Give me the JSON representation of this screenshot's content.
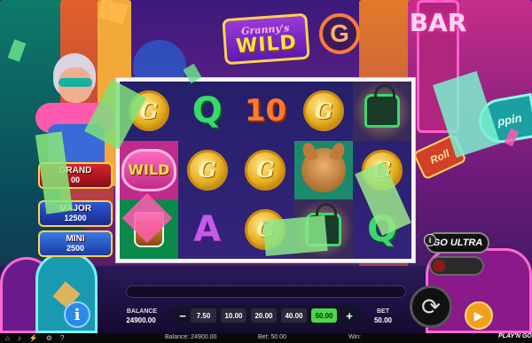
{
  "game": {
    "logo_top": "Granny's",
    "logo_main": "WILD"
  },
  "scene_signs": {
    "bar_sign": "BAR",
    "circle_sign": "G",
    "side_sign": "ppin",
    "side_sign2": "Roll"
  },
  "jackpots": [
    {
      "label": "GRAND",
      "value": "00"
    },
    {
      "label": "MAJOR",
      "value": "12500"
    },
    {
      "label": "MINI",
      "value": "2500"
    }
  ],
  "reels": [
    [
      "coin",
      "wild",
      "whisky"
    ],
    [
      "letter-q",
      "coin",
      "letter-a"
    ],
    [
      "num-10",
      "coin",
      "coin"
    ],
    [
      "coin",
      "dog",
      "handbag-alt"
    ],
    [
      "handbag",
      "coin",
      "letter-q"
    ]
  ],
  "symbols": {
    "coin": "G",
    "letter-q": "Q",
    "letter-a": "A",
    "num-10": "10",
    "wild": "WILD"
  },
  "go_ultra": {
    "label": "GO ULTRA",
    "info": "i"
  },
  "controls": {
    "info": "i",
    "balance_label": "BALANCE",
    "balance_value": "24900.00",
    "minus": "−",
    "plus": "+",
    "stakes": [
      "7.50",
      "10.00",
      "20.00",
      "40.00",
      "50.00"
    ],
    "selected_stake_index": 4,
    "bet_label": "BET",
    "bet_value": "50.00",
    "spin_icon": "⟳",
    "autoplay_icon": "▶"
  },
  "status_bar": {
    "balance": "Balance: 24900.00",
    "bet": "Bet: 50.00",
    "win": "Win:",
    "brand": "PLAY'N GO"
  },
  "colors": {
    "accent_gold": "#ffd24a",
    "stake_selected": "#4ad84a",
    "grand_jackpot": "#d8262a",
    "major_jackpot": "#2a5ad8"
  }
}
